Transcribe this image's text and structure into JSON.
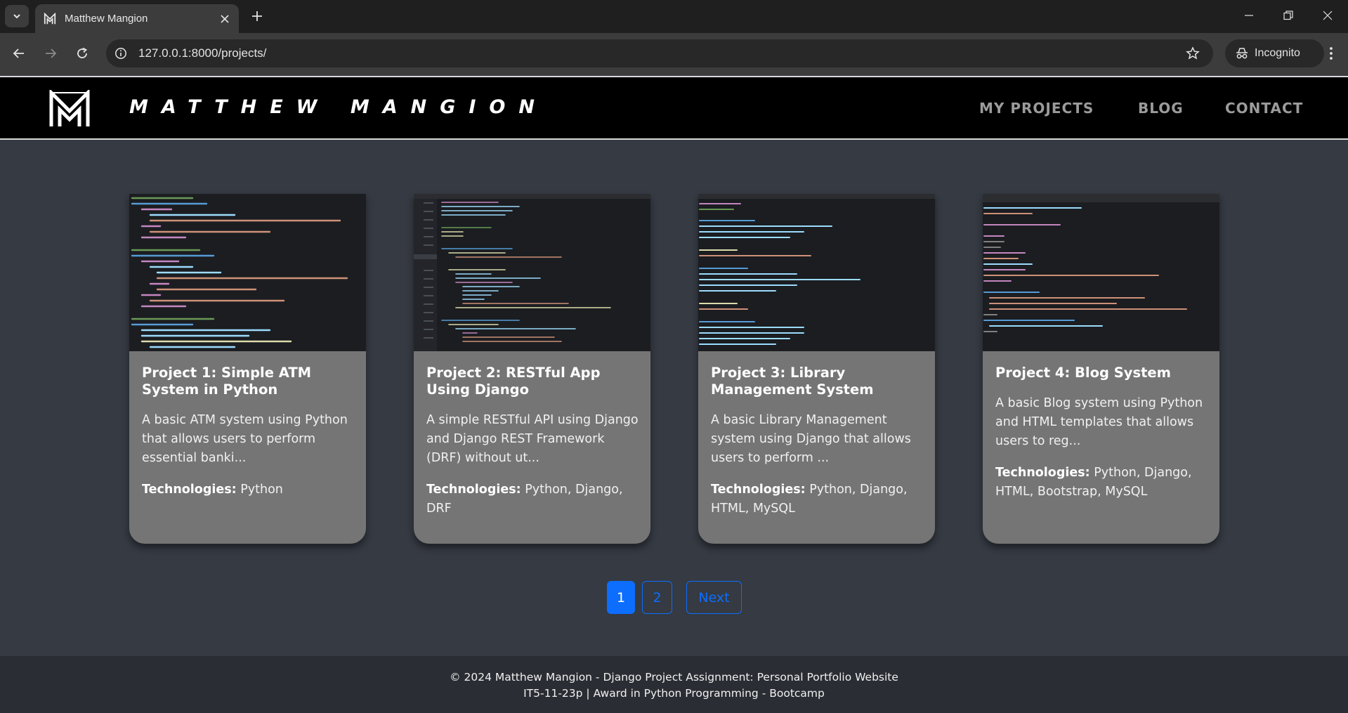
{
  "browser": {
    "tab_title": "Matthew Mangion",
    "url": "127.0.0.1:8000/projects/",
    "incognito_label": "Incognito"
  },
  "site": {
    "brand": "MATTHEW MANGION",
    "nav": [
      "MY PROJECTS",
      "BLOG",
      "CONTACT"
    ]
  },
  "projects": [
    {
      "title": "Project 1: Simple ATM System in Python",
      "description": "A basic ATM system using Python that allows users to perform essential banki...",
      "technologies_label": "Technologies:",
      "technologies": "Python"
    },
    {
      "title": "Project 2: RESTful App Using Django",
      "description": "A simple RESTful API using Django and Django REST Framework (DRF) without ut...",
      "technologies_label": "Technologies:",
      "technologies": "Python, Django, DRF"
    },
    {
      "title": "Project 3: Library Management System",
      "description": "A basic Library Management system using Django that allows users to perform ...",
      "technologies_label": "Technologies:",
      "technologies": "Python, Django, HTML, MySQL"
    },
    {
      "title": "Project 4: Blog System",
      "description": "A basic Blog system using Python and HTML templates that allows users to reg...",
      "technologies_label": "Technologies:",
      "technologies": "Python, Django, HTML, Bootstrap, MySQL"
    }
  ],
  "pagination": {
    "pages": [
      "1",
      "2"
    ],
    "current": "1",
    "next_label": "Next"
  },
  "footer": {
    "line1": "© 2024 Matthew Mangion - Django Project Assignment: Personal Portfolio Website",
    "line2": "IT5-11-23p | Award in Python Programming - Bootcamp"
  },
  "colors": {
    "page_bg": "#353a43",
    "header_bg": "#000000",
    "card_bg": "#757575",
    "nav_text": "#9b9b9b",
    "accent_blue": "#0d6efd",
    "footer_bg": "#2a2d33"
  }
}
